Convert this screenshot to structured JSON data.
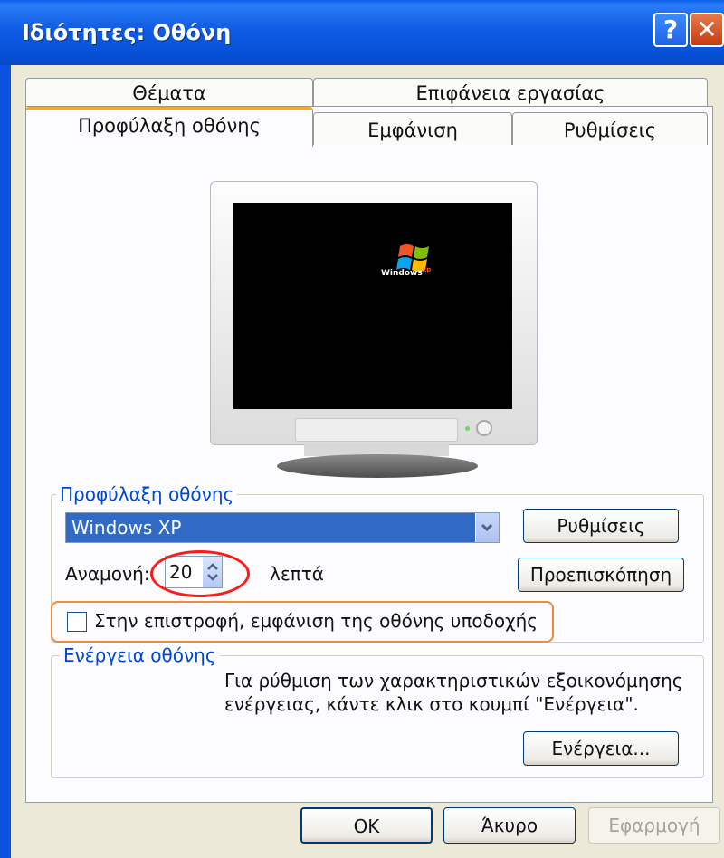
{
  "window": {
    "title": "Ιδιότητες: Οθόνη",
    "help_glyph": "?",
    "close_glyph": "✕",
    "accent_color": "#0a53e2"
  },
  "tabs": {
    "row_back": [
      "Θέματα",
      "Επιφάνεια εργασίας"
    ],
    "row_front": [
      "Προφύλαξη οθόνης",
      "Εμφάνιση",
      "Ρυθμίσεις"
    ],
    "active": "Προφύλαξη οθόνης"
  },
  "preview": {
    "logo_text": "Windows",
    "logo_superscript": "xp"
  },
  "screensaver_group": {
    "title": "Προφύλαξη οθόνης",
    "selected": "Windows XP",
    "settings_button": "Ρυθμίσεις",
    "preview_button": "Προεπισκόπηση",
    "wait_label": "Αναμονή:",
    "wait_value": "20",
    "wait_unit": "λεπτά",
    "password_checkbox_label": "Στην επιστροφή, εμφάνιση της οθόνης υποδοχής",
    "password_checkbox_checked": false
  },
  "power_group": {
    "title": "Ενέργεια οθόνης",
    "description_line1": "Για ρύθμιση των χαρακτηριστικών εξοικονόμησης",
    "description_line2": "ενέργειας, κάντε κλικ στο κουμπί \"Ενέργεια\".",
    "power_button": "Ενέργεια..."
  },
  "footer": {
    "ok": "OK",
    "cancel": "Άκυρο",
    "apply": "Εφαρμογή"
  },
  "annotations": {
    "wait_highlight_color": "#ff1a1a",
    "checkbox_highlight_color": "#ef8a3c"
  }
}
